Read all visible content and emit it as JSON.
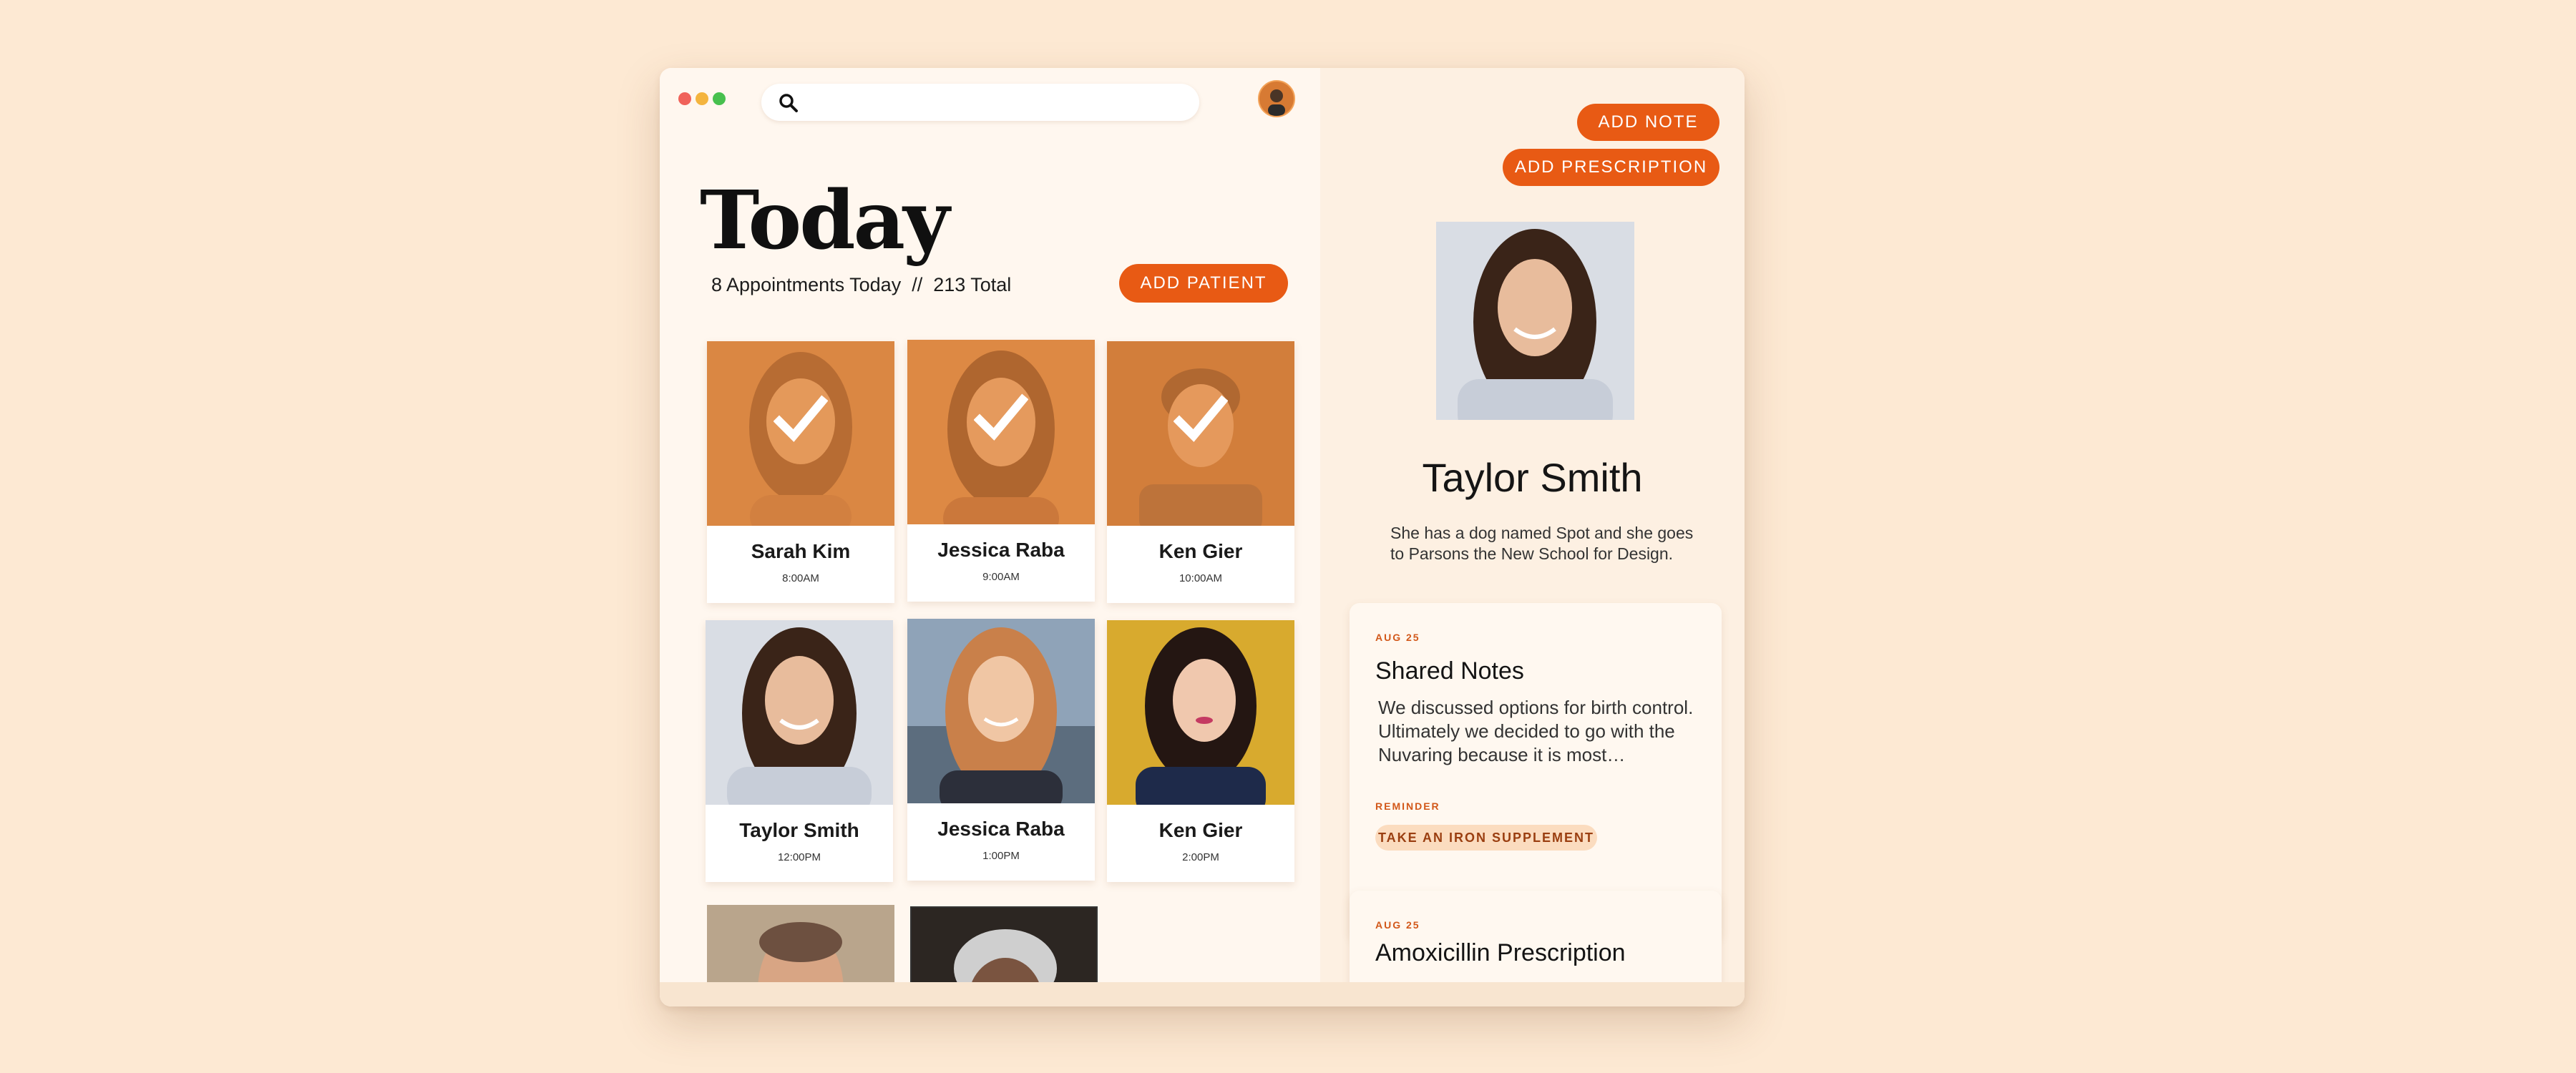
{
  "window": {
    "search": {
      "placeholder": ""
    }
  },
  "header": {
    "title": "Today",
    "subtitle": "8 Appointments Today  //  213 Total",
    "add_patient_label": "ADD PATIENT"
  },
  "appointments": [
    {
      "name": "Sarah Kim",
      "time": "8:00AM",
      "completed": true
    },
    {
      "name": "Jessica Raba",
      "time": "9:00AM",
      "completed": true
    },
    {
      "name": "Ken Gier",
      "time": "10:00AM",
      "completed": true
    },
    {
      "name": "Taylor Smith",
      "time": "12:00PM",
      "completed": false
    },
    {
      "name": "Jessica Raba",
      "time": "1:00PM",
      "completed": false
    },
    {
      "name": "Ken Gier",
      "time": "2:00PM",
      "completed": false
    }
  ],
  "detail": {
    "add_note_label": "ADD NOTE",
    "add_prescription_label": "ADD PRESCRIPTION",
    "patient_name": "Taylor Smith",
    "description": "She has a dog named Spot and she goes to Parsons the New School for Design.",
    "notes": [
      {
        "date": "AUG 25",
        "title": "Shared Notes",
        "body": "We discussed options for birth control. Ultimately we decided to go with the Nuvaring because it is most…",
        "reminder_label": "REMINDER",
        "reminder_tag": "TAKE AN IRON SUPPLEMENT"
      },
      {
        "date": "AUG 25",
        "title": "Amoxicillin Prescription"
      }
    ]
  },
  "colors": {
    "accent": "#e85a14",
    "background": "#fde9d3",
    "completed_overlay": "#e8893a"
  }
}
